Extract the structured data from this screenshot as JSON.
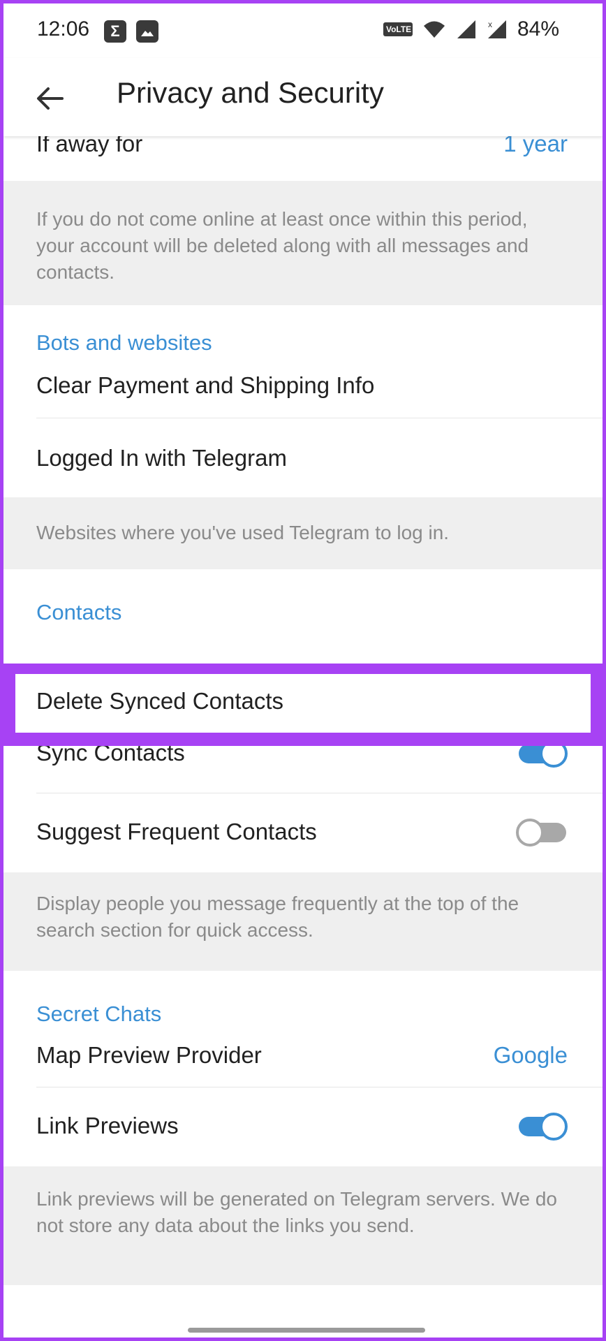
{
  "status_bar": {
    "time": "12:06",
    "battery": "84%",
    "volte": "Vo LTE1",
    "left_icons": [
      "sigma-icon",
      "image-icon"
    ],
    "right_icons": [
      "volte-icon",
      "wifi-icon",
      "signal-icon",
      "signal-x-icon"
    ]
  },
  "header": {
    "title": "Privacy and Security"
  },
  "rows": {
    "away": {
      "label": "If away for",
      "value": "1 year"
    },
    "away_info": "If you do not come online at least once within this period, your account will be deleted along with all messages and contacts.",
    "bots_section": "Bots and websites",
    "clear_payment": "Clear Payment and Shipping Info",
    "logged_in": "Logged In with Telegram",
    "websites_info": "Websites where you've used Telegram to log in.",
    "contacts_section": "Contacts",
    "delete_synced": "Delete Synced Contacts",
    "sync_contacts": {
      "label": "Sync Contacts",
      "enabled": true
    },
    "suggest_frequent": {
      "label": "Suggest Frequent Contacts",
      "enabled": false
    },
    "suggest_info": "Display people you message frequently at the top of the search section for quick access.",
    "secret_section": "Secret Chats",
    "map_preview": {
      "label": "Map Preview Provider",
      "value": "Google"
    },
    "link_previews": {
      "label": "Link Previews",
      "enabled": true
    },
    "link_info": "Link previews will be generated on Telegram servers. We do not store any data about the links you send."
  },
  "colors": {
    "accent": "#3a8fd4",
    "highlight": "#a742f4",
    "info_bg": "#efefef"
  }
}
